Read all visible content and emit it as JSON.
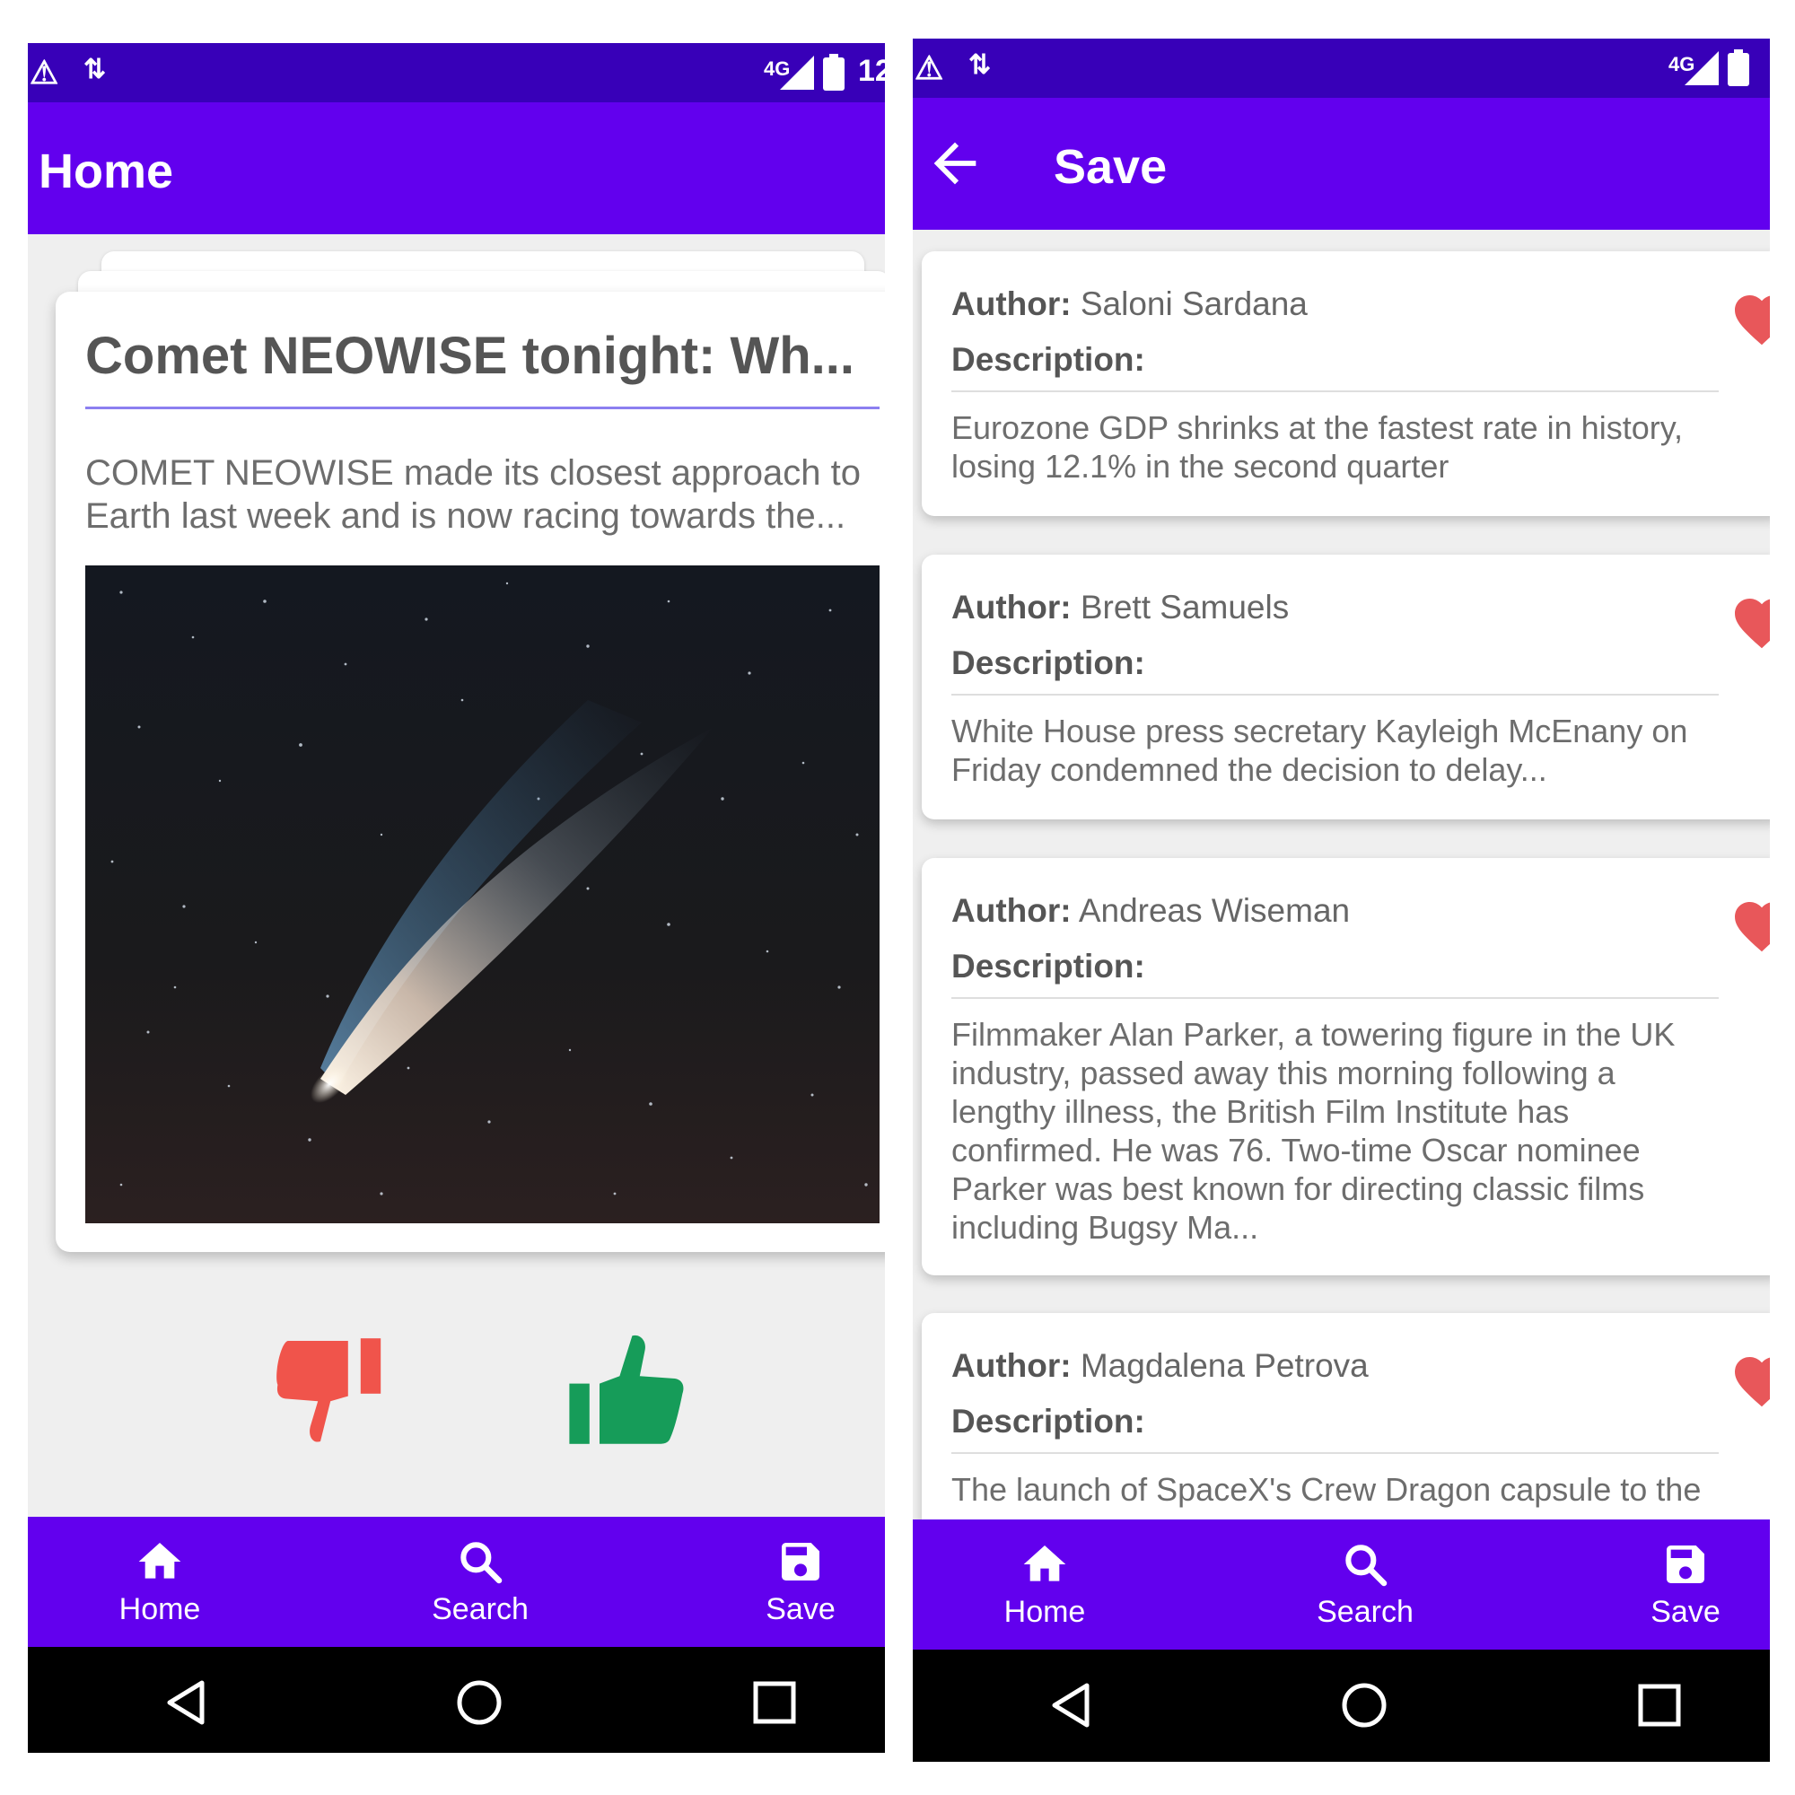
{
  "colors": {
    "primary": "#6200ee",
    "status_bar": "#3800b8",
    "dislike": "#f0544b",
    "like": "#169c59",
    "heart": "#e8575a",
    "background": "#efefef"
  },
  "home_screen": {
    "status_bar": {
      "network": "4G",
      "time_fragment": "12"
    },
    "app_bar": {
      "title": "Home"
    },
    "card": {
      "title": "Comet NEOWISE tonight: Wh...",
      "description": "COMET NEOWISE made its closest approach to Earth last week and is now racing towards the...",
      "image": "comet-photo"
    },
    "actions": {
      "dislike_icon": "thumbs-down-icon",
      "like_icon": "thumbs-up-icon"
    }
  },
  "save_screen": {
    "status_bar": {
      "network": "4G"
    },
    "app_bar": {
      "title": "Save",
      "back_icon": "arrow-back-icon"
    },
    "author_label": "Author:",
    "description_label": "Description:",
    "items": [
      {
        "author": "Saloni Sardana",
        "description": "Eurozone GDP shrinks at the fastest rate in history, losing 12.1% in the second quarter"
      },
      {
        "author": "Brett Samuels",
        "description": "White House press secretary Kayleigh McEnany on Friday condemned the decision to delay..."
      },
      {
        "author": "Andreas Wiseman",
        "description": "Filmmaker Alan Parker, a towering figure in the UK industry, passed away this morning following a lengthy illness, the British Film Institute has confirmed. He was 76. Two-time Oscar nominee Parker was best known for directing classic films including Bugsy Ma..."
      },
      {
        "author": "Magdalena Petrova",
        "description": "The launch of SpaceX's Crew Dragon capsule to the"
      }
    ]
  },
  "bottom_nav": {
    "home": {
      "label": "Home",
      "icon": "home-icon"
    },
    "search": {
      "label": "Search",
      "icon": "search-icon"
    },
    "save": {
      "label": "Save",
      "icon": "save-icon"
    }
  }
}
